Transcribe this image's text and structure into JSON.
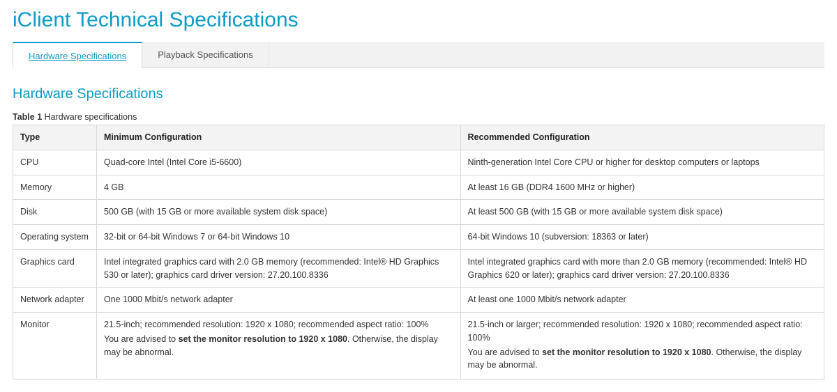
{
  "page": {
    "title": "iClient Technical Specifications"
  },
  "tabs": [
    {
      "label": "Hardware Specifications",
      "active": true
    },
    {
      "label": "Playback Specifications",
      "active": false
    }
  ],
  "section": {
    "title": "Hardware Specifications",
    "table_label_bold": "Table 1",
    "table_label_rest": " Hardware specifications"
  },
  "table": {
    "headers": {
      "type": "Type",
      "min": "Minimum Configuration",
      "rec": "Recommended Configuration"
    },
    "rows": [
      {
        "type": "CPU",
        "min": "Quad-core Intel (Intel Core i5-6600)",
        "rec": "Ninth-generation Intel Core CPU or higher for desktop computers or laptops"
      },
      {
        "type": "Memory",
        "min": "4 GB",
        "rec": "At least 16 GB (DDR4 1600 MHz or higher)"
      },
      {
        "type": "Disk",
        "min": "500 GB (with 15 GB or more available system disk space)",
        "rec": "At least 500 GB (with 15 GB or more available system disk space)"
      },
      {
        "type": "Operating system",
        "min": "32-bit or 64-bit Windows 7 or 64-bit Windows 10",
        "rec": "64-bit Windows 10 (subversion: 18363 or later)"
      },
      {
        "type": "Graphics card",
        "min": "Intel integrated graphics card with 2.0 GB memory (recommended: Intel® HD Graphics 530 or later); graphics card driver version: 27.20.100.8336",
        "rec": "Intel integrated graphics card with more than 2.0 GB memory (recommended: Intel® HD Graphics 620 or later); graphics card driver version: 27.20.100.8336"
      },
      {
        "type": "Network adapter",
        "min": "One 1000 Mbit/s network adapter",
        "rec": "At least one 1000 Mbit/s network adapter"
      },
      {
        "type": "Monitor",
        "min_line1": "21.5-inch; recommended resolution: 1920 x 1080; recommended aspect ratio: 100%",
        "min_line2_pre": "You are advised to ",
        "min_line2_bold": "set the monitor resolution to 1920 x 1080",
        "min_line2_post": ". Otherwise, the display may be abnormal.",
        "rec_line1": "21.5-inch or larger; recommended resolution: 1920 x 1080; recommended aspect ratio: 100%",
        "rec_line2_pre": "You are advised to ",
        "rec_line2_bold": "set the monitor resolution to 1920 x 1080",
        "rec_line2_post": ". Otherwise, the display may be abnormal."
      }
    ]
  }
}
